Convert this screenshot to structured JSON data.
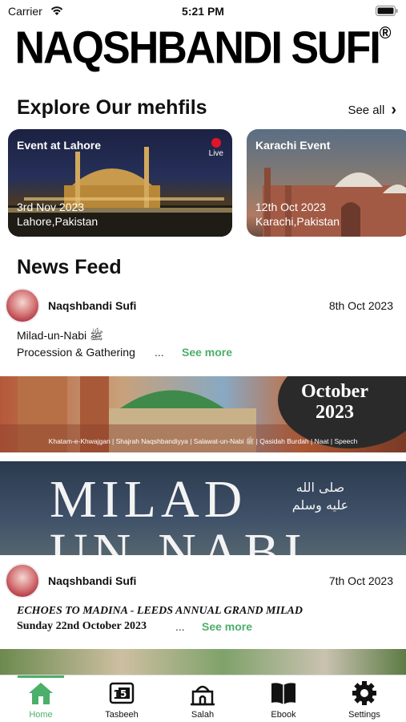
{
  "status_bar": {
    "carrier": "Carrier",
    "time": "5:21 PM"
  },
  "brand": {
    "name": "NAQSHBANDI SUFI",
    "registered": "®"
  },
  "mehfils": {
    "title": "Explore Our mehfils",
    "see_all": "See all",
    "events": [
      {
        "title": "Event at Lahore",
        "date": "3rd Nov 2023",
        "place": "Lahore,Pakistan",
        "live": "Live"
      },
      {
        "title": "Karachi Event",
        "date": "12th Oct 2023",
        "place": "Karachi,Pakistan"
      }
    ]
  },
  "news_feed": {
    "title": "News Feed",
    "posts": [
      {
        "author": "Naqshbandi Sufi",
        "date": "8th Oct 2023",
        "line1": "Milad-un-Nabi ﷺ",
        "line2": "Procession & Gathering",
        "ellipsis": "...",
        "see_more": "See more",
        "banner_month": "October",
        "banner_year": "2023",
        "banner_strip": "Khatam-e-Khwajgan | Shajrah Naqshbandiyya | Salawat-un-Nabi ﷺ | Qasidah Burdah | Naat | Speech"
      },
      {
        "banner_title_1": "MILAD",
        "banner_title_2": "UN-NABI",
        "banner_calligraphy": "صلى الله عليه وسلم"
      },
      {
        "author": "Naqshbandi Sufi",
        "date": "7th Oct 2023",
        "line1": "ECHOES TO MADINA - LEEDS ANNUAL GRAND MILAD",
        "line2": "Sunday 22nd October 2023",
        "ellipsis": "...",
        "see_more": "See more"
      }
    ]
  },
  "tab_bar": {
    "tabs": [
      {
        "label": "Home",
        "icon": "home-icon"
      },
      {
        "label": "Tasbeeh",
        "icon": "tasbeeh-icon"
      },
      {
        "label": "Salah",
        "icon": "mosque-icon"
      },
      {
        "label": "Ebook",
        "icon": "book-icon"
      },
      {
        "label": "Settings",
        "icon": "gear-icon"
      }
    ],
    "active_color": "#4caf6a"
  }
}
